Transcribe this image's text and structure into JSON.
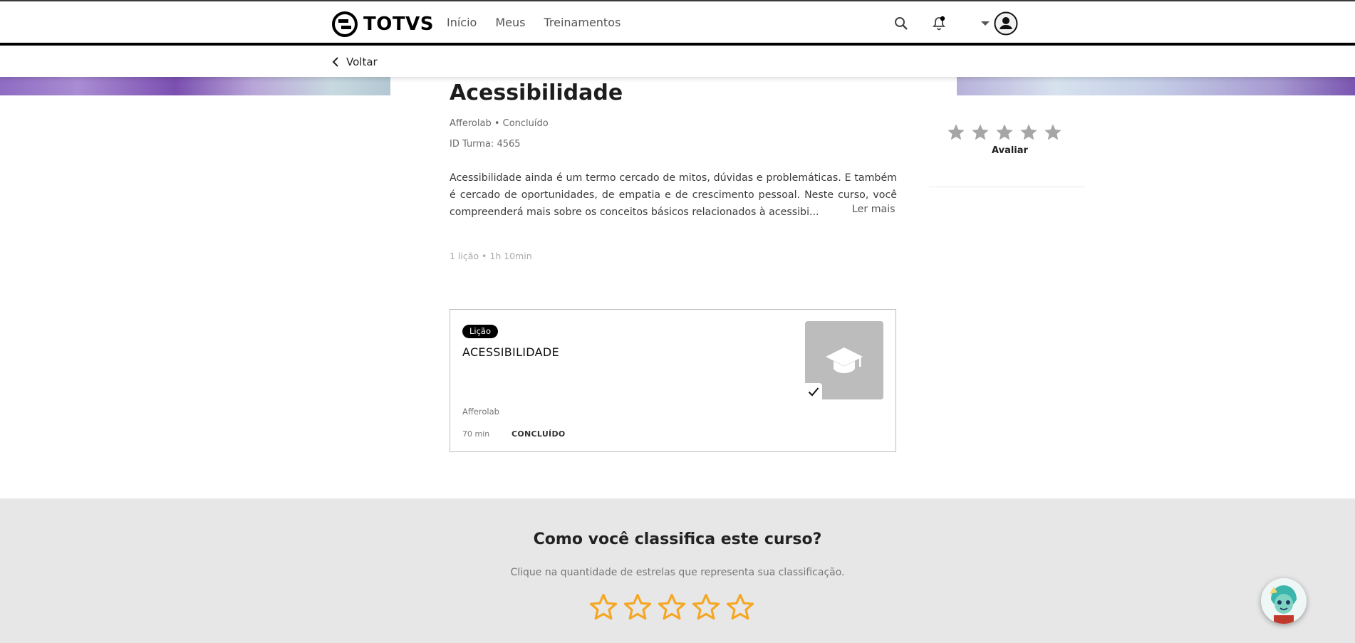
{
  "header": {
    "logo_text": "TOTVS",
    "nav": [
      "Início",
      "Meus",
      "Treinamentos"
    ]
  },
  "subbar": {
    "back_label": "Voltar"
  },
  "course": {
    "title": "Acessibilidade",
    "meta": "Afferolab • Concluído",
    "turma": "ID Turma: 4565",
    "description": "Acessibilidade ainda é um termo cercado de mitos, dúvidas e problemáticas. E também é cercado de oportunidades, de empatia e de crescimento pessoal. Neste curso, você compreenderá mais sobre os conceitos básicos relacionados à acessibi...",
    "read_more": "Ler mais",
    "summary": "1 lição • 1h 10min"
  },
  "lesson_card": {
    "badge": "Lição",
    "title": "ACESSIBILIDADE",
    "author": "Afferolab",
    "duration": "70 min",
    "status": "CONCLUÍDO"
  },
  "side_rating": {
    "label": "Avaliar",
    "stars": 5,
    "star_color": "#a6a6a6"
  },
  "footer": {
    "title": "Como você classifica este curso?",
    "subtitle": "Clique na quantidade de estrelas que representa sua classificação.",
    "stars": 5,
    "star_color": "#f5a623"
  }
}
